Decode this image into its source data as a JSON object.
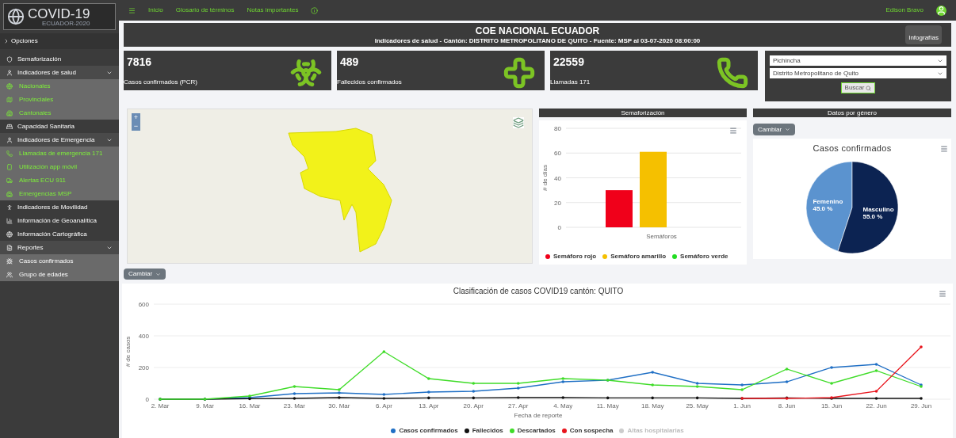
{
  "logo": {
    "title": "COVID-19",
    "subtitle": "ECUADOR-2020"
  },
  "nav": {
    "links": [
      "Inicio",
      "Glosario de términos",
      "Notas importantes"
    ],
    "user": "Edison Bravo"
  },
  "sidebar": {
    "heading": "Opciones",
    "items": [
      {
        "label": "Semaforización"
      },
      {
        "label": "Indicadores de salud",
        "expanded": true,
        "accent": true,
        "children": [
          {
            "label": "Nacionales"
          },
          {
            "label": "Provinciales"
          },
          {
            "label": "Cantonales"
          }
        ]
      },
      {
        "label": "Capacidad Sanitaria"
      },
      {
        "label": "Indicadores de Emergencia",
        "expanded": true,
        "accent": true,
        "children": [
          {
            "label": "Llamadas de emergencia 171"
          },
          {
            "label": "Utilización app móvil"
          },
          {
            "label": "Alertas ECU 911"
          },
          {
            "label": "Emergencias MSP"
          }
        ]
      },
      {
        "label": "Indicadores de Movilidad"
      },
      {
        "label": "Información de Geoanalítica"
      },
      {
        "label": "Información Cartográfica"
      },
      {
        "label": "Reportes",
        "expanded": true,
        "accent": false,
        "children": [
          {
            "label": "Casos confirmados"
          },
          {
            "label": "Grupo de edades"
          }
        ]
      }
    ]
  },
  "header": {
    "title": "COE NACIONAL ECUADOR",
    "subtitle": "Indicadores de salud - Cantón: DISTRITO METROPOLITANO DE QUITO - Fuente: MSP al 03-07-2020 08:00:00",
    "button": "Infografías"
  },
  "stats": [
    {
      "value": "7816",
      "label": "Casos confirmados (PCR)"
    },
    {
      "value": "489",
      "label": "Fallecidos confirmados"
    },
    {
      "value": "22559",
      "label": "Llamadas 171"
    }
  ],
  "filters": {
    "province": "Pichincha",
    "canton": "Distrito Metropolitano de Quito",
    "button": "Buscar"
  },
  "map": {
    "zoom_in": "+",
    "zoom_out": "−"
  },
  "semaforo": {
    "title": "Semaforización",
    "chart_data": {
      "type": "bar",
      "ylabel": "# de días",
      "categories": [
        "Semáforos"
      ],
      "ylim": [
        0,
        80
      ],
      "yticks": [
        0,
        20,
        40,
        60,
        80
      ],
      "grid": true,
      "legend": true,
      "series": [
        {
          "name": "Semáforo rojo",
          "color": "#f0001a",
          "values": [
            30
          ]
        },
        {
          "name": "Semáforo amarillo",
          "color": "#f5c000",
          "values": [
            61
          ]
        },
        {
          "name": "Semáforo verde",
          "color": "#22dd22",
          "values": [
            0
          ]
        }
      ]
    }
  },
  "gender": {
    "title": "Datos por género",
    "button": "Cambiar",
    "chart_data": {
      "type": "pie",
      "title": "Casos confirmados",
      "categories": [
        "Femenino",
        "Masculino"
      ],
      "values": [
        45.0,
        55.0
      ],
      "value_labels": [
        "45.0 %",
        "55.0 %"
      ]
    }
  },
  "cases": {
    "button": "Cambiar",
    "chart_data": {
      "type": "line",
      "title": "Clasificación de casos COVID19 cantón: QUITO",
      "xlabel": "Fecha de reporte",
      "ylabel": "# de casos",
      "ylim": [
        0,
        600
      ],
      "yticks": [
        0,
        200,
        400,
        600
      ],
      "grid": true,
      "legend": true,
      "categories": [
        "2. Mar",
        "9. Mar",
        "16. Mar",
        "23. Mar",
        "30. Mar",
        "6. Apr",
        "13. Apr",
        "20. Apr",
        "27. Apr",
        "4. May",
        "11. May",
        "18. May",
        "25. May",
        "1. Jun",
        "8. Jun",
        "15. Jun",
        "22. Jun",
        "29. Jun"
      ],
      "series": [
        {
          "name": "Casos confirmados",
          "color": "#1f6fc5",
          "values": [
            0,
            0,
            10,
            35,
            40,
            30,
            45,
            50,
            70,
            110,
            120,
            170,
            100,
            90,
            110,
            200,
            220,
            90
          ]
        },
        {
          "name": "Fallecidos",
          "color": "#111111",
          "values": [
            0,
            0,
            3,
            5,
            10,
            5,
            8,
            8,
            10,
            10,
            8,
            8,
            8,
            5,
            8,
            5,
            5,
            5
          ]
        },
        {
          "name": "Descartados",
          "color": "#3fdc28",
          "values": [
            0,
            0,
            20,
            80,
            60,
            300,
            130,
            100,
            100,
            130,
            120,
            90,
            80,
            60,
            190,
            100,
            180,
            80
          ]
        },
        {
          "name": "Con sospecha",
          "color": "#e8141c",
          "values": [
            null,
            null,
            null,
            null,
            null,
            null,
            null,
            null,
            null,
            null,
            null,
            null,
            null,
            5,
            5,
            10,
            50,
            330
          ]
        },
        {
          "name": "Altas hospitalarias",
          "color": "#cccccc",
          "values": [
            null,
            null,
            null,
            null,
            null,
            null,
            null,
            null,
            null,
            null,
            null,
            null,
            null,
            null,
            null,
            null,
            null,
            null
          ]
        }
      ]
    }
  }
}
